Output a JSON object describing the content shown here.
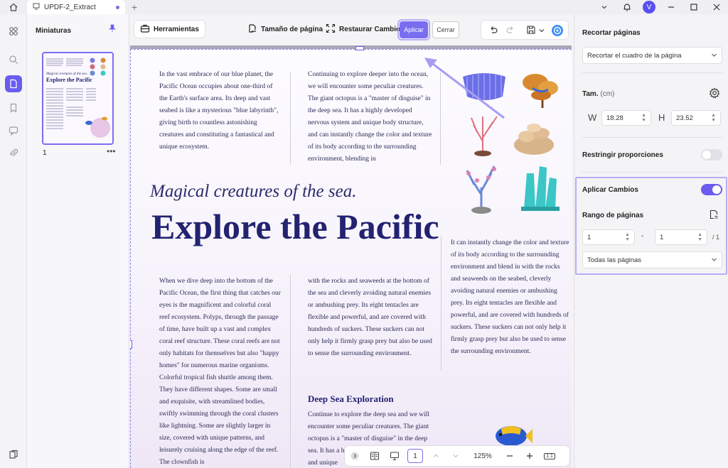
{
  "titlebar": {
    "tab_name": "UPDF-2_Extract",
    "plus": "+",
    "avatar": "V",
    "accent": "#6b5cf0"
  },
  "sidebar": {
    "thumbs_title": "Miniaturas",
    "page_num": "1",
    "more": "•••"
  },
  "toolbar": {
    "tools": "Herramientas",
    "page_size": "Tamaño de página",
    "restore": "Restaurar Cambios",
    "apply": "Aplicar",
    "close": "Cerrar"
  },
  "document": {
    "col1": "In the vast embrace of our blue planet, the Pacific Ocean occupies about one-third of the Earth's surface area. Its deep and vast seabed is like a mysterious \"blue labyrinth\", giving birth to countless astonishing creatures and constituting a fantastical and unique ecosystem.",
    "col2": "Continuing to explore deeper into the ocean, we will encounter some peculiar creatures. The giant octopus is a \"master of disguise\" in the deep sea. It has a highly developed nervous system and unique body structure, and can instantly change the color and texture of its body according to the surrounding environment, blending in",
    "subtitle": "Magical creatures of the sea.",
    "title": "Explore the Pacific",
    "col_right": "It can instantly change the color and texture of its body according to the surrounding environment and blend in with the rocks and seaweeds on the seabed, cleverly avoiding natural enemies or ambushing prey. Its eight tentacles are flexible and powerful, and are covered with hundreds of suckers. These suckers can not only help it firmly grasp prey but also be used to sense the surrounding environment.",
    "col3": "When we dive deep into the bottom of the Pacific Ocean, the first thing that catches our eyes is the magnificent and colorful coral reef ecosystem. Polyps, through the passage of time, have built up a vast and complex coral reef structure. These coral reefs are not only habitats for themselves but also \"happy homes\" for numerous marine organisms. Colorful tropical fish shuttle among them. They have different shapes. Some are small and exquisite, with streamlined bodies, swiftly swimming through the coral clusters like lightning. Some are slightly larger in size, covered with unique patterns, and leisurely cruising along the edge of the reef. The clownfish is",
    "col4": "with the rocks and seaweeds at the bottom of the sea and cleverly avoiding natural enemies or ambushing prey. Its eight tentacles are flexible and powerful, and are covered with hundreds of suckers. These suckers can not only help it firmly grasp prey but also be used to sense the surrounding environment.",
    "h3": "Deep Sea Exploration",
    "col5": "Continue to explore the deep sea and we will encounter some peculiar creatures. The giant octopus is a \"master of disguise\" in the deep sea. It has a highly developed nervous system and unique"
  },
  "bottombar": {
    "page": "1",
    "zoom": "125%",
    "fit": "1:1"
  },
  "panel": {
    "crop_pages": "Recortar páginas",
    "crop_mode": "Recortar el cuadro de la página",
    "size": "Tam.",
    "size_unit": "(cm)",
    "w_label": "W",
    "w_value": "18.28",
    "h_label": "H",
    "h_value": "23.52",
    "constrain": "Restringir proporciones",
    "apply_changes": "Aplicar Cambios",
    "page_range": "Rango de páginas",
    "range_from": "1",
    "range_dash": "-",
    "range_to": "1",
    "range_total": "/ 1",
    "range_mode": "Todas las páginas"
  }
}
